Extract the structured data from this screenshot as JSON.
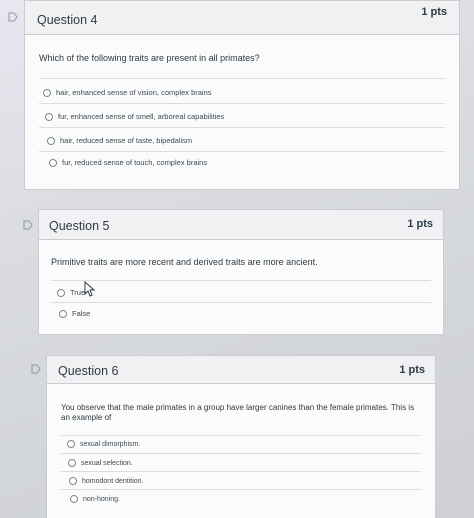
{
  "questions": [
    {
      "title": "Question 4",
      "points": "1 pts",
      "text": "Which of the following traits are present in all primates?",
      "options": [
        "hair, enhanced sense of vision, complex brains",
        "fur, enhanced sense of smell, arboreal capabilities",
        "hair, reduced sense of taste, bipedalism",
        "fur, reduced sense of touch, complex brains"
      ]
    },
    {
      "title": "Question 5",
      "points": "1 pts",
      "text": "Primitive traits are more recent and derived traits are more ancient.",
      "options": [
        "True",
        "False"
      ]
    },
    {
      "title": "Question 6",
      "points": "1 pts",
      "text_line1": "You observe that the male primates in a group have larger canines than the female primates. This is",
      "text_line2": "an example of",
      "options": [
        "sexual dimorphism.",
        "sexual selection.",
        "homodont dentition.",
        "non-honing."
      ]
    }
  ],
  "colors": {
    "card_bg": "#fbfbfb",
    "header_bg": "#f1f1f3",
    "border": "#c7cdd1",
    "text": "#2d3b45"
  }
}
